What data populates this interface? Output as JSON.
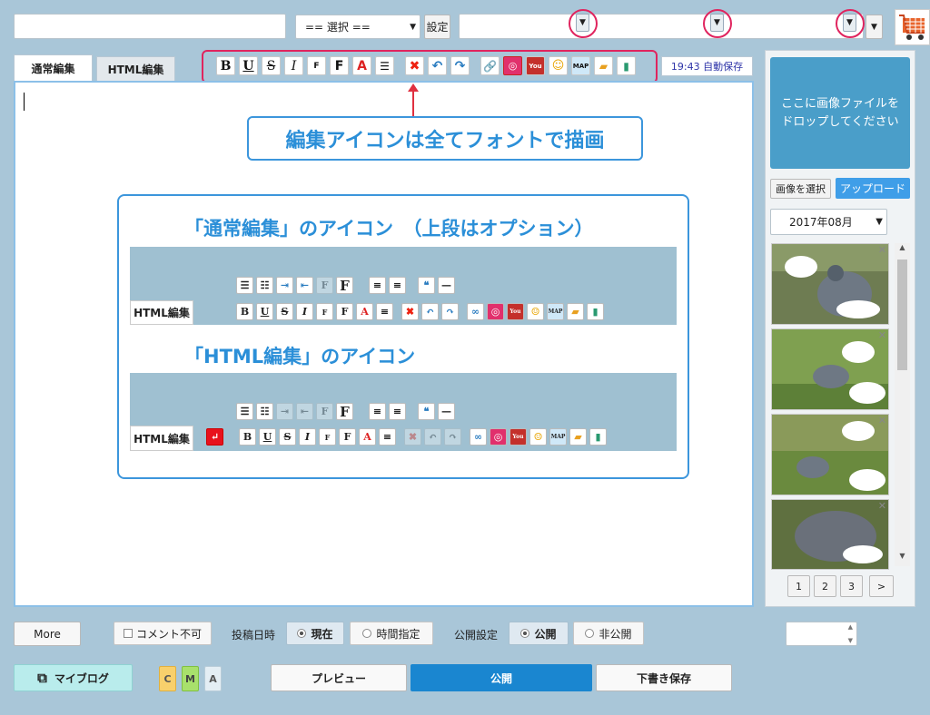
{
  "top": {
    "select_default": "== 選択 ==",
    "settings_label": "設定"
  },
  "tabs": [
    {
      "label": "通常編集"
    },
    {
      "label": "HTML編集"
    }
  ],
  "toolbar": {
    "bold": "B",
    "underline": "U",
    "strike": "S",
    "italic": "I",
    "font_small": "F",
    "font_big": "F",
    "autosave": "19:43 自動保存",
    "map": "MAP"
  },
  "callout": {
    "text": "編集アイコンは全てフォントで描画"
  },
  "info_box": {
    "normal_title": "「通常編集」のアイコン　（上段はオプション）",
    "html_title": "「HTML編集」のアイコン",
    "tab_label": "HTML編集"
  },
  "sidebar": {
    "drop_text": "ここに画像ファイルを\nドロップしてください",
    "select_image": "画像を選択",
    "upload": "アップロード",
    "month": "2017年08月",
    "pages": [
      "1",
      "2",
      "3",
      ">"
    ]
  },
  "footer": {
    "more": "More",
    "no_comment": "コメント不可",
    "post_time_label": "投稿日時",
    "now": "現在",
    "time_specify": "時間指定",
    "publish_setting_label": "公開設定",
    "public": "公開",
    "private": "非公開",
    "my_blog": "マイブログ",
    "cma": [
      "C",
      "M",
      "A"
    ],
    "preview": "プレビュー",
    "publish": "公開",
    "draft": "下書き保存"
  },
  "colors": {
    "accent": "#2b8fd8",
    "callout_text": "#2b8fd8",
    "highlight_ring": "#e0245e",
    "publish_btn": "#1a86d0"
  }
}
